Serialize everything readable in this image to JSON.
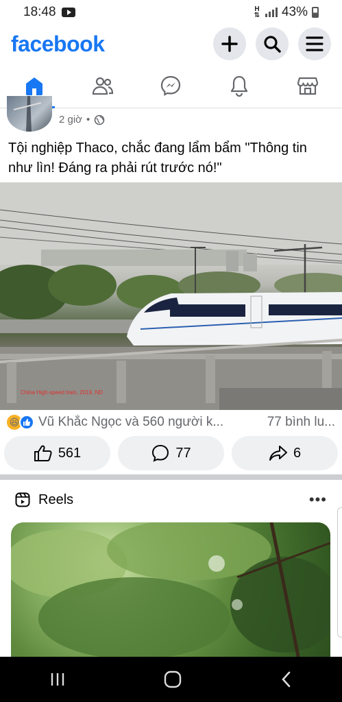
{
  "status_bar": {
    "time": "18:48",
    "network": "H",
    "battery": "43%"
  },
  "header": {
    "logo": "facebook"
  },
  "post": {
    "time": "2 giờ",
    "separator": "•",
    "text": "Tội nghiệp Thaco, chắc đang lẩm bẩm \"Thông tin như lìn! Đáng ra phải rút trước nó!\"",
    "photo_caption": "China High-speed train, 2019, ND",
    "reactions_text": "Vũ Khắc Ngọc và 560 người k...",
    "comments_text": "77 bình lu...",
    "like_count": "561",
    "comment_count": "77",
    "share_count": "6"
  },
  "reels": {
    "title": "Reels"
  },
  "colors": {
    "brand": "#1877f2",
    "button_bg": "#e4e6eb"
  }
}
